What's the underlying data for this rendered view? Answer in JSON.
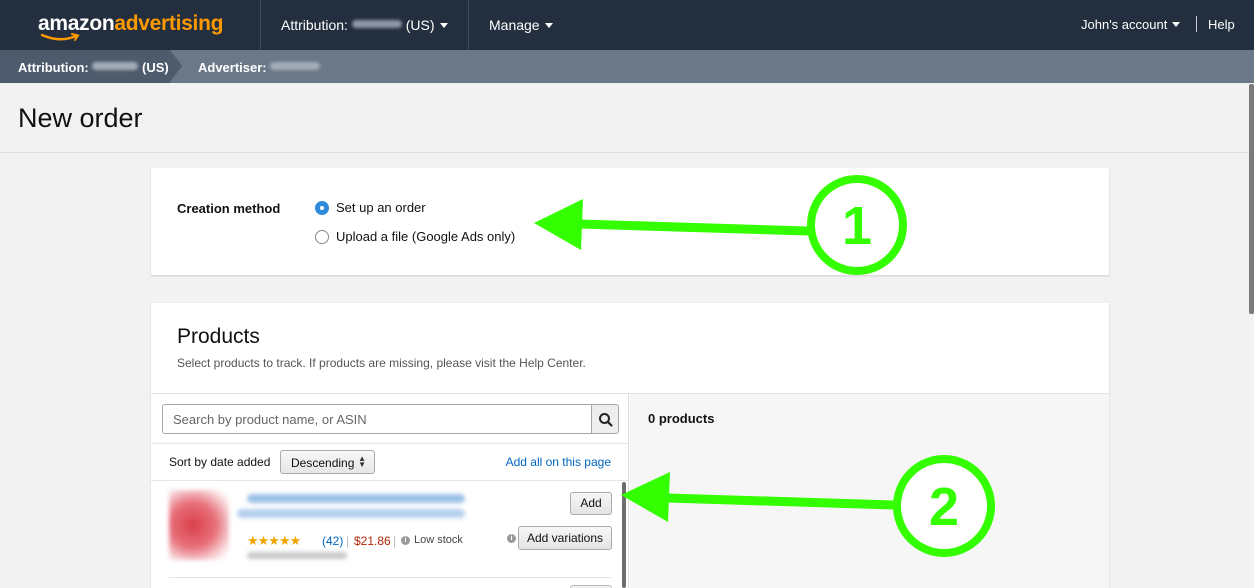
{
  "topnav": {
    "logo_amazon": "amazon",
    "logo_advertising": "advertising",
    "attribution_prefix": "Attribution:",
    "attribution_suffix": "(US)",
    "manage": "Manage",
    "account": "John's account",
    "help": "Help"
  },
  "breadcrumb": {
    "attribution_prefix": "Attribution:",
    "attribution_suffix": "(US)",
    "advertiser_prefix": "Advertiser:"
  },
  "page": {
    "title": "New order"
  },
  "creation": {
    "label": "Creation method",
    "options": [
      {
        "label": "Set up an order",
        "selected": true
      },
      {
        "label": "Upload a file (Google Ads only)",
        "selected": false
      }
    ]
  },
  "products": {
    "title": "Products",
    "subtitle": "Select products to track. If products are missing, please visit the Help Center.",
    "search_placeholder": "Search by product name, or ASIN",
    "sort_label": "Sort by date added",
    "sort_value": "Descending",
    "add_all": "Add all on this page",
    "selected_count": "0 products",
    "items": [
      {
        "stars": "★★★★★",
        "rating_count": "(42)",
        "price": "$21.86",
        "stock": "Low stock",
        "add_label": "Add",
        "add_variations_label": "Add variations"
      }
    ]
  },
  "annotations": {
    "one": "1",
    "two": "2",
    "color": "#33ff00"
  },
  "icons": [
    "search-icon",
    "caret-down-icon",
    "info-icon",
    "amazon-smile-icon"
  ],
  "colors": {
    "nav_bg": "#232f3e",
    "accent": "#ff9900",
    "link": "#0066c0",
    "price": "#b12704",
    "radio_selected": "#2d8ad8"
  }
}
